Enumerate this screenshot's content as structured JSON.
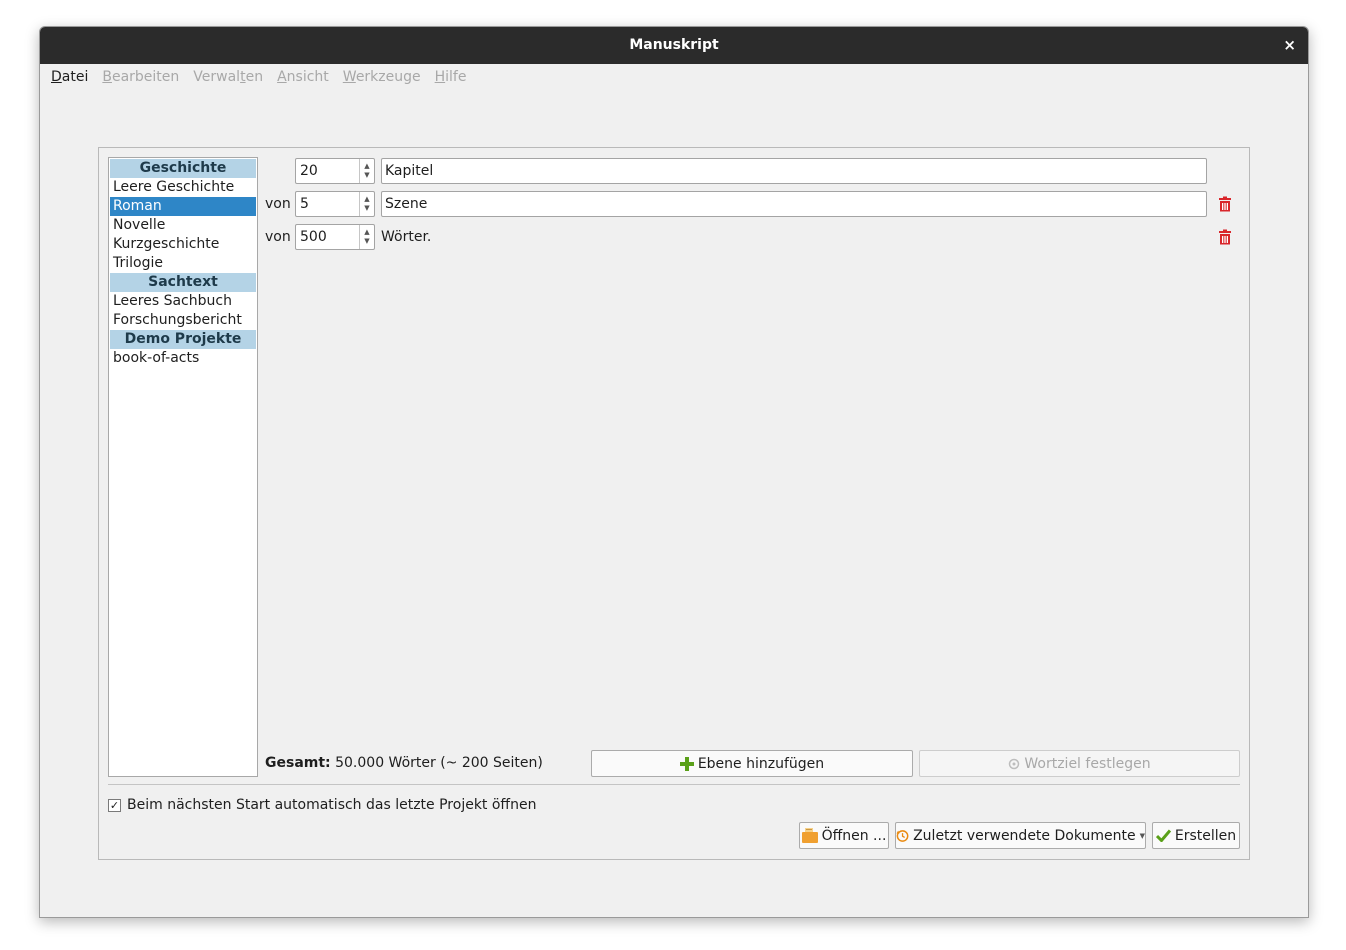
{
  "window": {
    "title": "Manuskript",
    "close_glyph": "×"
  },
  "menu": [
    {
      "label": "Datei",
      "accel_index": 0,
      "enabled": true
    },
    {
      "label": "Bearbeiten",
      "accel_index": 0,
      "enabled": false
    },
    {
      "label": "Verwalten",
      "accel_index": 6,
      "enabled": false
    },
    {
      "label": "Ansicht",
      "accel_index": 0,
      "enabled": false
    },
    {
      "label": "Werkzeuge",
      "accel_index": 0,
      "enabled": false
    },
    {
      "label": "Hilfe",
      "accel_index": 0,
      "enabled": false
    }
  ],
  "templates": [
    {
      "type": "header",
      "label": "Geschichte"
    },
    {
      "type": "item",
      "label": "Leere Geschichte"
    },
    {
      "type": "item",
      "label": "Roman",
      "selected": true
    },
    {
      "type": "item",
      "label": "Novelle"
    },
    {
      "type": "item",
      "label": "Kurzgeschichte"
    },
    {
      "type": "item",
      "label": "Trilogie"
    },
    {
      "type": "header",
      "label": "Sachtext"
    },
    {
      "type": "item",
      "label": "Leeres Sachbuch"
    },
    {
      "type": "item",
      "label": "Forschungsbericht"
    },
    {
      "type": "header",
      "label": "Demo Projekte"
    },
    {
      "type": "item",
      "label": "book-of-acts"
    }
  ],
  "levels": [
    {
      "prefix": "",
      "count": "20",
      "name": "Kapitel",
      "deletable": false
    },
    {
      "prefix": "von",
      "count": "5",
      "name": "Szene",
      "deletable": true
    }
  ],
  "words_row": {
    "prefix": "von",
    "count": "500",
    "label": "Wörter."
  },
  "total": {
    "label": "Gesamt:",
    "value": "50.000 Wörter (~ 200 Seiten)"
  },
  "buttons": {
    "add_level": "Ebene hinzufügen",
    "word_goal": "Wortziel festlegen",
    "open": "Öffnen ...",
    "recent": "Zuletzt verwendete Dokumente",
    "create": "Erstellen"
  },
  "autoload": {
    "label": "Beim nächsten Start automatisch das letzte Projekt öffnen",
    "checked": true,
    "check_glyph": "✓"
  },
  "colors": {
    "titlebar": "#2b2b2b",
    "selection": "#2e86c7",
    "list_header": "#b4d3e6",
    "delete_red": "#d9262b",
    "add_green": "#5aa019",
    "open_orange": "#f0a030"
  }
}
